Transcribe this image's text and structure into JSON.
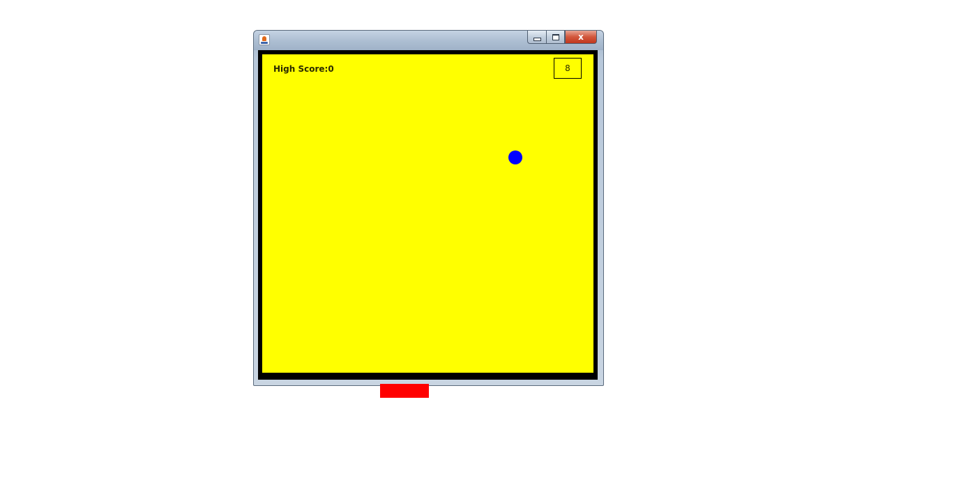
{
  "window": {
    "title": "",
    "controls": {
      "minimize_icon": "minimize-icon",
      "maximize_icon": "maximize-icon",
      "close_label": "x"
    }
  },
  "game": {
    "high_score_label": "High Score:0",
    "current_score": "8",
    "colors": {
      "background": "#ffff00",
      "border": "#000000",
      "ball": "#0000ff",
      "paddle": "#ff0000"
    }
  }
}
